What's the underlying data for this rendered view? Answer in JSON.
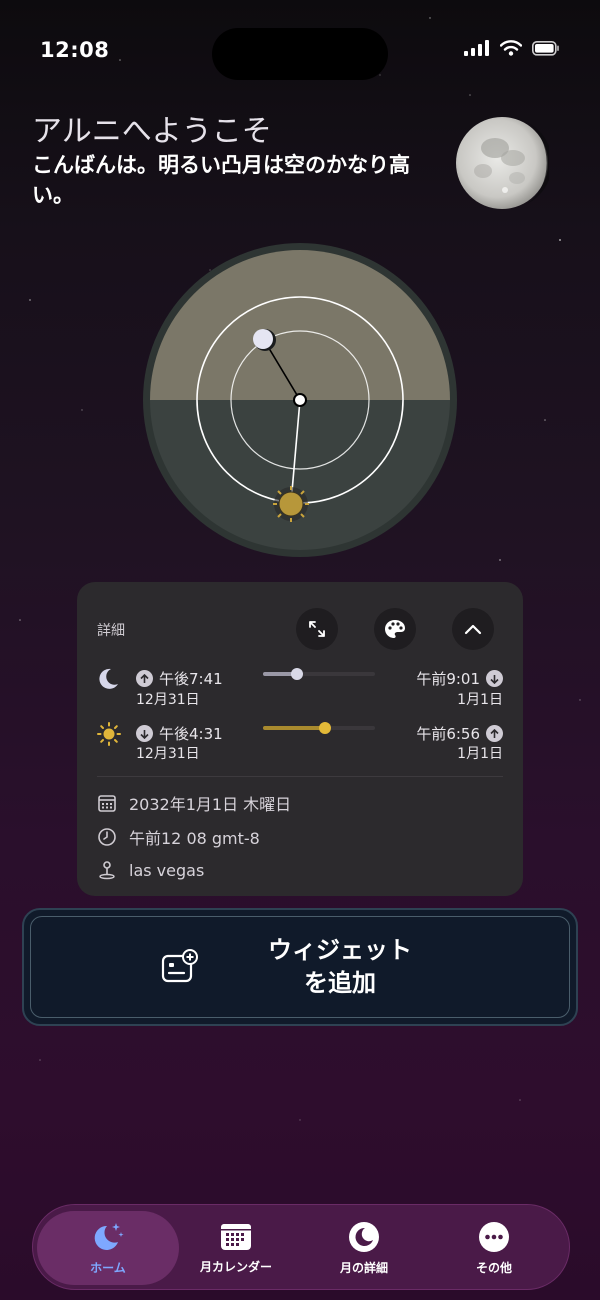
{
  "status_bar": {
    "time": "12:08"
  },
  "greeting": {
    "title": "アルニへようこそ",
    "subtitle": "こんばんは。明るい凸月は空のかなり高い。"
  },
  "details": {
    "label": "詳細",
    "moon": {
      "rise_time": "午後7:41",
      "rise_date": "12月31日",
      "set_time": "午前9:01",
      "set_date": "1月1日",
      "progress": 0.3
    },
    "sun": {
      "set_time": "午後4:31",
      "set_date": "12月31日",
      "rise_time": "午前6:56",
      "rise_date": "1月1日",
      "progress": 0.55
    },
    "date": "2032年1月1日 木曜日",
    "clock": "午前12 08 gmt-8",
    "location": "las vegas"
  },
  "add_widget": {
    "label": "ウィジェット\nを追加"
  },
  "tabs": [
    {
      "label": "ホーム",
      "icon": "moon-stars-icon",
      "active": true
    },
    {
      "label": "月カレンダー",
      "icon": "calendar-icon",
      "active": false
    },
    {
      "label": "月の詳細",
      "icon": "moon-icon",
      "active": false
    },
    {
      "label": "その他",
      "icon": "more-icon",
      "active": false
    }
  ],
  "colors": {
    "accent_blue": "#7ea8ff",
    "sun_gold": "#c9a43c",
    "dial_sky": "#7b7768",
    "dial_ground": "#3b4240"
  }
}
